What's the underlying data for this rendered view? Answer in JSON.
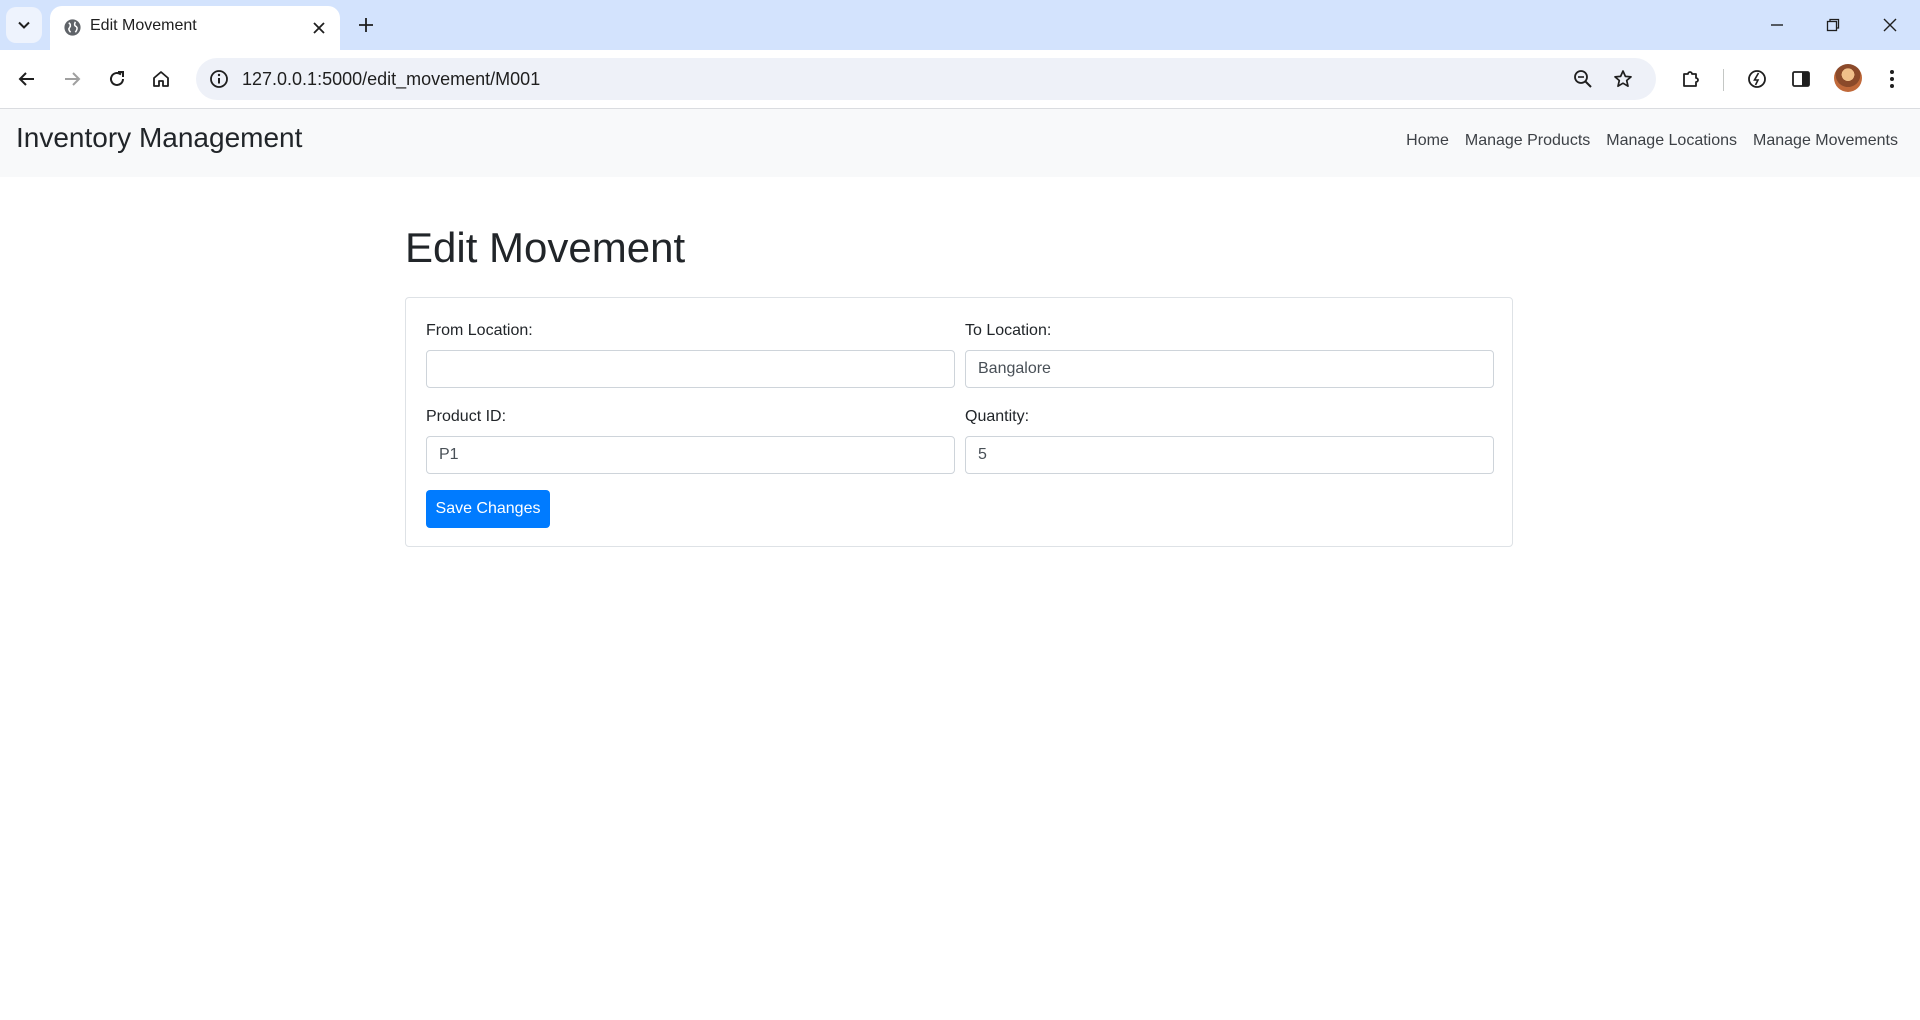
{
  "browser": {
    "tab_title": "Edit Movement",
    "url": "127.0.0.1:5000/edit_movement/M001"
  },
  "app": {
    "brand": "Inventory Management",
    "nav": [
      "Home",
      "Manage Products",
      "Manage Locations",
      "Manage Movements"
    ]
  },
  "form": {
    "title": "Edit Movement",
    "from_location": {
      "label": "From Location:",
      "value": ""
    },
    "to_location": {
      "label": "To Location:",
      "value": "Bangalore"
    },
    "product_id": {
      "label": "Product ID:",
      "value": "P1"
    },
    "quantity": {
      "label": "Quantity:",
      "value": "5"
    },
    "submit_label": "Save Changes"
  },
  "colors": {
    "primary": "#007bff",
    "navbar_bg": "#f8f9fa",
    "tabstrip_bg": "#d3e3fd"
  }
}
